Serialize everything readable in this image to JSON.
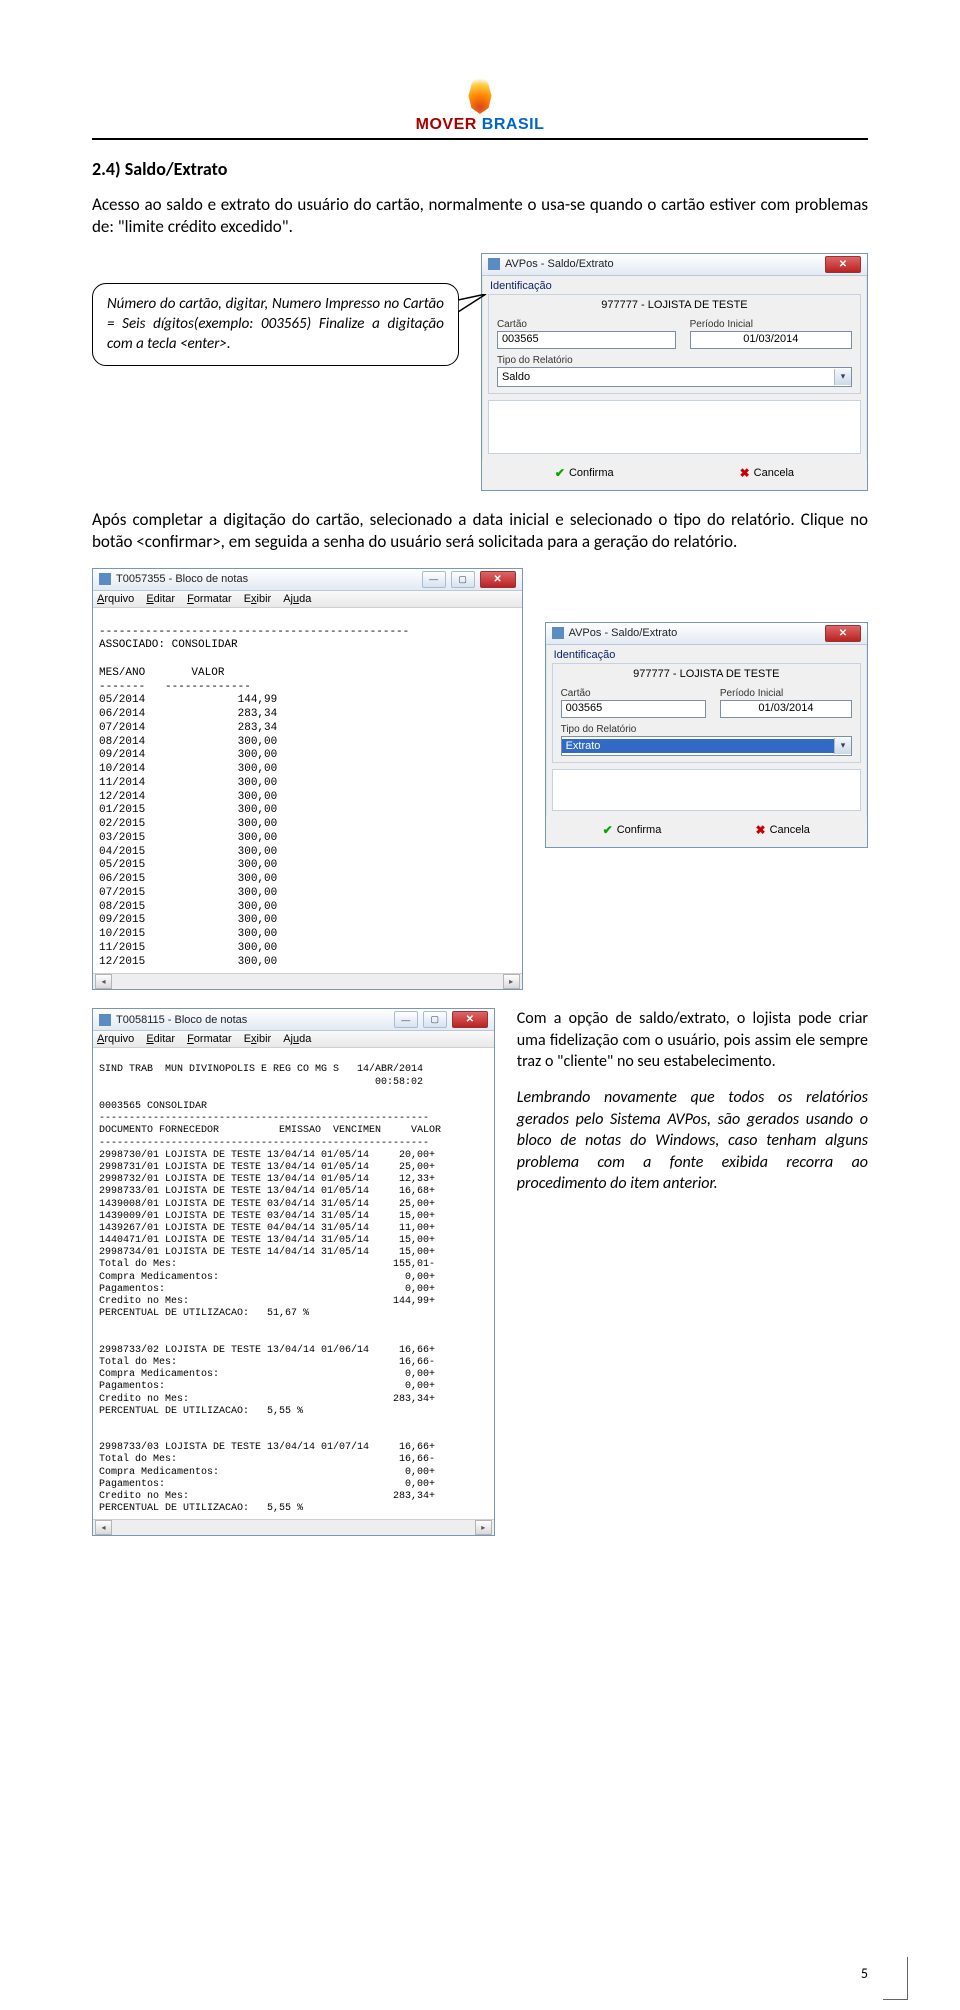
{
  "brand": {
    "part1": "MOVER ",
    "part2": "BRASIL"
  },
  "section_title": "2.4) Saldo/Extrato",
  "intro": "Acesso ao saldo e extrato do usuário do cartão, normalmente o usa-se quando o cartão estiver com problemas de: \"limite crédito excedido\".",
  "callout": "Número do cartão, digitar, Numero Impresso no Cartão = Seis dígitos(exemplo: 003565) Finalize a digitação com a tecla <enter>.",
  "paragraph2": "Após completar a digitação do cartão, selecionado a data inicial e selecionado o tipo do relatório. Clique no botão <confirmar>, em seguida a senha do usuário será solicitada para a geração do relatório.",
  "side1": "Com a opção de saldo/extrato, o lojista pode criar uma fidelização com o usuário, pois assim ele sempre traz o \"cliente\" no seu estabelecimento.",
  "side2": "Lembrando novamente que todos os relatórios gerados pelo Sistema AVPos, são gerados usando o bloco de notas do Windows, caso tenham alguns problema com a fonte exibida recorra ao procedimento do item anterior.",
  "page_number": "5",
  "dialog1": {
    "title": "AVPos - Saldo/Extrato",
    "group": "Identificação",
    "subtitle": "977777 - LOJISTA DE TESTE",
    "lbl_card": "Cartão",
    "card_val": "003565",
    "lbl_period": "Período Inicial",
    "period_val": "01/03/2014",
    "lbl_type": "Tipo do Relatório",
    "type_val": "Saldo",
    "btn_ok": "Confirma",
    "btn_cancel": "Cancela"
  },
  "dialog2": {
    "title": "AVPos - Saldo/Extrato",
    "group": "Identificação",
    "subtitle": "977777 - LOJISTA DE TESTE",
    "lbl_card": "Cartão",
    "card_val": "003565",
    "lbl_period": "Período Inicial",
    "period_val": "01/03/2014",
    "lbl_type": "Tipo do Relatório",
    "type_val": "Extrato",
    "btn_ok": "Confirma",
    "btn_cancel": "Cancela"
  },
  "notepad_menu": {
    "file": "Arquivo",
    "edit": "Editar",
    "format": "Formatar",
    "show": "Exibir",
    "help": "Ajuda"
  },
  "notepad1": {
    "title": "T0057355 - Bloco de notas",
    "header_line1": "ASSOCIADO: CONSOLIDAR",
    "col_head": "MES/ANO       VALOR",
    "col_sep": "-------   -------------",
    "rows": [
      [
        "05/2014",
        "144,99"
      ],
      [
        "06/2014",
        "283,34"
      ],
      [
        "07/2014",
        "283,34"
      ],
      [
        "08/2014",
        "300,00"
      ],
      [
        "09/2014",
        "300,00"
      ],
      [
        "10/2014",
        "300,00"
      ],
      [
        "11/2014",
        "300,00"
      ],
      [
        "12/2014",
        "300,00"
      ],
      [
        "01/2015",
        "300,00"
      ],
      [
        "02/2015",
        "300,00"
      ],
      [
        "03/2015",
        "300,00"
      ],
      [
        "04/2015",
        "300,00"
      ],
      [
        "05/2015",
        "300,00"
      ],
      [
        "06/2015",
        "300,00"
      ],
      [
        "07/2015",
        "300,00"
      ],
      [
        "08/2015",
        "300,00"
      ],
      [
        "09/2015",
        "300,00"
      ],
      [
        "10/2015",
        "300,00"
      ],
      [
        "11/2015",
        "300,00"
      ],
      [
        "12/2015",
        "300,00"
      ]
    ]
  },
  "notepad2": {
    "title": "T0058115 - Bloco de notas",
    "header_l1": "SIND TRAB  MUN DIVINOPOLIS E REG CO MG S   14/ABR/2014",
    "header_l2": "                                              00:58:02",
    "assoc": "0003565 CONSOLIDAR",
    "cols": "DOCUMENTO FORNECEDOR          EMISSAO  VENCIMEN     VALOR",
    "sep": "-------------------------------------------------------",
    "block1": [
      "2998730/01 LOJISTA DE TESTE 13/04/14 01/05/14     20,00+",
      "2998731/01 LOJISTA DE TESTE 13/04/14 01/05/14     25,00+",
      "2998732/01 LOJISTA DE TESTE 13/04/14 01/05/14     12,33+",
      "2998733/01 LOJISTA DE TESTE 13/04/14 01/05/14     16,68+",
      "1439008/01 LOJISTA DE TESTE 03/04/14 31/05/14     25,00+",
      "1439009/01 LOJISTA DE TESTE 03/04/14 31/05/14     15,00+",
      "1439267/01 LOJISTA DE TESTE 04/04/14 31/05/14     11,00+",
      "1440471/01 LOJISTA DE TESTE 13/04/14 31/05/14     15,00+",
      "2998734/01 LOJISTA DE TESTE 14/04/14 31/05/14     15,00+",
      "Total do Mes:                                    155,01-",
      "Compra Medicamentos:                               0,00+",
      "Pagamentos:                                        0,00+",
      "Credito no Mes:                                  144,99+",
      "PERCENTUAL DE UTILIZACAO:   51,67 %"
    ],
    "block2": [
      "2998733/02 LOJISTA DE TESTE 13/04/14 01/06/14     16,66+",
      "Total do Mes:                                     16,66-",
      "Compra Medicamentos:                               0,00+",
      "Pagamentos:                                        0,00+",
      "Credito no Mes:                                  283,34+",
      "PERCENTUAL DE UTILIZACAO:   5,55 %"
    ],
    "block3": [
      "2998733/03 LOJISTA DE TESTE 13/04/14 01/07/14     16,66+",
      "Total do Mes:                                     16,66-",
      "Compra Medicamentos:                               0,00+",
      "Pagamentos:                                        0,00+",
      "Credito no Mes:                                  283,34+",
      "PERCENTUAL DE UTILIZACAO:   5,55 %"
    ]
  }
}
